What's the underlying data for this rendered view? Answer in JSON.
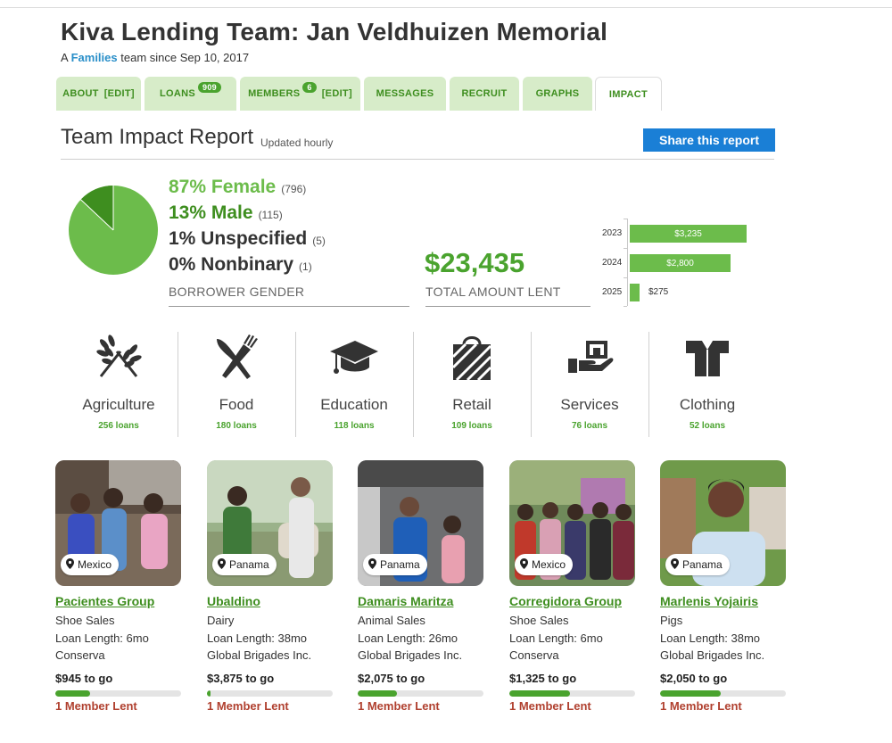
{
  "team": {
    "title": "Kiva Lending Team: Jan Veldhuizen Memorial",
    "sub_prefix": "A",
    "category_link": "Families",
    "sub_suffix": "team since Sep 10, 2017"
  },
  "tabs": [
    {
      "label": "ABOUT",
      "edit": "[EDIT]"
    },
    {
      "label": "LOANS",
      "badge": "909"
    },
    {
      "label": "MEMBERS",
      "badge": "6",
      "edit": "[EDIT]"
    },
    {
      "label": "MESSAGES"
    },
    {
      "label": "RECRUIT"
    },
    {
      "label": "GRAPHS"
    },
    {
      "label": "IMPACT"
    }
  ],
  "report": {
    "title": "Team Impact Report",
    "updated": "Updated hourly",
    "share_label": "Share this report"
  },
  "gender": {
    "rows": [
      {
        "pct": "87% Female",
        "count": "(796)"
      },
      {
        "pct": "13% Male",
        "count": "(115)"
      },
      {
        "pct": "1% Unspecified",
        "count": "(5)"
      },
      {
        "pct": "0% Nonbinary",
        "count": "(1)"
      }
    ],
    "label": "BORROWER GENDER",
    "pie_shares": [
      87,
      13
    ],
    "colors": {
      "female": "#6cbc4b",
      "male": "#3e8e1f"
    }
  },
  "total": {
    "amount": "$23,435",
    "label": "TOTAL AMOUNT LENT"
  },
  "years": [
    {
      "year": "2023",
      "amount": "$3,235",
      "value": 3235
    },
    {
      "year": "2024",
      "amount": "$2,800",
      "value": 2800
    },
    {
      "year": "2025",
      "amount": "$275",
      "value": 275
    }
  ],
  "sectors": [
    {
      "name": "Agriculture",
      "loans": "256 loans",
      "icon": "wheat-icon"
    },
    {
      "name": "Food",
      "loans": "180 loans",
      "icon": "fork-knife-icon"
    },
    {
      "name": "Education",
      "loans": "118 loans",
      "icon": "graduation-cap-icon"
    },
    {
      "name": "Retail",
      "loans": "109 loans",
      "icon": "shopping-bag-icon"
    },
    {
      "name": "Services",
      "loans": "76 loans",
      "icon": "hand-service-icon"
    },
    {
      "name": "Clothing",
      "loans": "52 loans",
      "icon": "shirt-icon"
    }
  ],
  "loans": [
    {
      "location": "Mexico",
      "name": "Pacientes Group",
      "activity": "Shoe Sales",
      "length": "Loan Length: 6mo",
      "partner": "Conserva",
      "togo": "$945 to go",
      "progress": 0.28,
      "lent": "1 Member Lent"
    },
    {
      "location": "Panama",
      "name": "Ubaldino",
      "activity": "Dairy",
      "length": "Loan Length: 38mo",
      "partner": "Global Brigades Inc.",
      "togo": "$3,875 to go",
      "progress": 0.03,
      "lent": "1 Member Lent"
    },
    {
      "location": "Panama",
      "name": "Damaris Maritza",
      "activity": "Animal Sales",
      "length": "Loan Length: 26mo",
      "partner": "Global Brigades Inc.",
      "togo": "$2,075 to go",
      "progress": 0.31,
      "lent": "1 Member Lent"
    },
    {
      "location": "Mexico",
      "name": "Corregidora Group",
      "activity": "Shoe Sales",
      "length": "Loan Length: 6mo",
      "partner": "Conserva",
      "togo": "$1,325 to go",
      "progress": 0.48,
      "lent": "1 Member Lent"
    },
    {
      "location": "Panama",
      "name": "Marlenis Yojairis",
      "activity": "Pigs",
      "length": "Loan Length: 38mo",
      "partner": "Global Brigades Inc.",
      "togo": "$2,050 to go",
      "progress": 0.48,
      "lent": "1 Member Lent"
    }
  ]
}
